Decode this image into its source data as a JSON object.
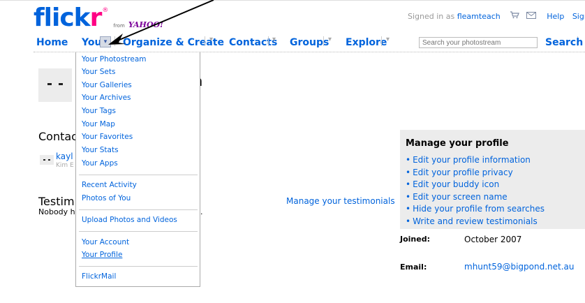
{
  "logo": {
    "part1": "flick",
    "part2": "r",
    "reg": "®",
    "from": "from",
    "yahoo": "YAHOO!"
  },
  "userbar": {
    "signed_in_prefix": "Signed in as ",
    "username": "fleamteach",
    "cart_icon": "cart-icon",
    "mail_icon": "mail-icon",
    "help": "Help",
    "sign_out": "Sign Ou"
  },
  "nav": {
    "home": "Home",
    "you": "You",
    "organize": "Organize & Create",
    "contacts": "Contacts",
    "groups": "Groups",
    "explore": "Explore",
    "arrow_glyph": "▾"
  },
  "search": {
    "placeholder": "Search your photostream",
    "button": "Search"
  },
  "menu": {
    "items": [
      "Your Photostream",
      "Your Sets",
      "Your Galleries",
      "Your Archives",
      "Your Tags",
      "Your Map",
      "Your Favorites",
      "Your Stats",
      "Your Apps",
      "Recent Activity",
      "Photos of You",
      "Upload Photos and Videos",
      "Your Account",
      "Your Profile",
      "FlickrMail"
    ]
  },
  "page": {
    "title_visible": "ch",
    "contacts_heading": "Contac",
    "contact_name": "kayl",
    "contact_sub": "Kim E",
    "testimonials_heading": "Testim",
    "testimonials_none": "Nobody ha",
    "testimonials_none_end": ".",
    "manage_testimonials": "Manage your testimonials"
  },
  "profile": {
    "heading": "Manage your profile",
    "links": [
      "Edit your profile information",
      "Edit your profile privacy",
      "Edit your buddy icon",
      "Edit your screen name",
      "Hide your profile from searches",
      "Write and review testimonials"
    ],
    "joined_label": "Joined:",
    "joined_value": "October 2007",
    "email_label": "Email:",
    "email_value": "mhunt59@bigpond.net.au"
  },
  "colors": {
    "link": "#0063dc",
    "flickr_pink": "#ff0084",
    "box_bg": "#ececec"
  }
}
